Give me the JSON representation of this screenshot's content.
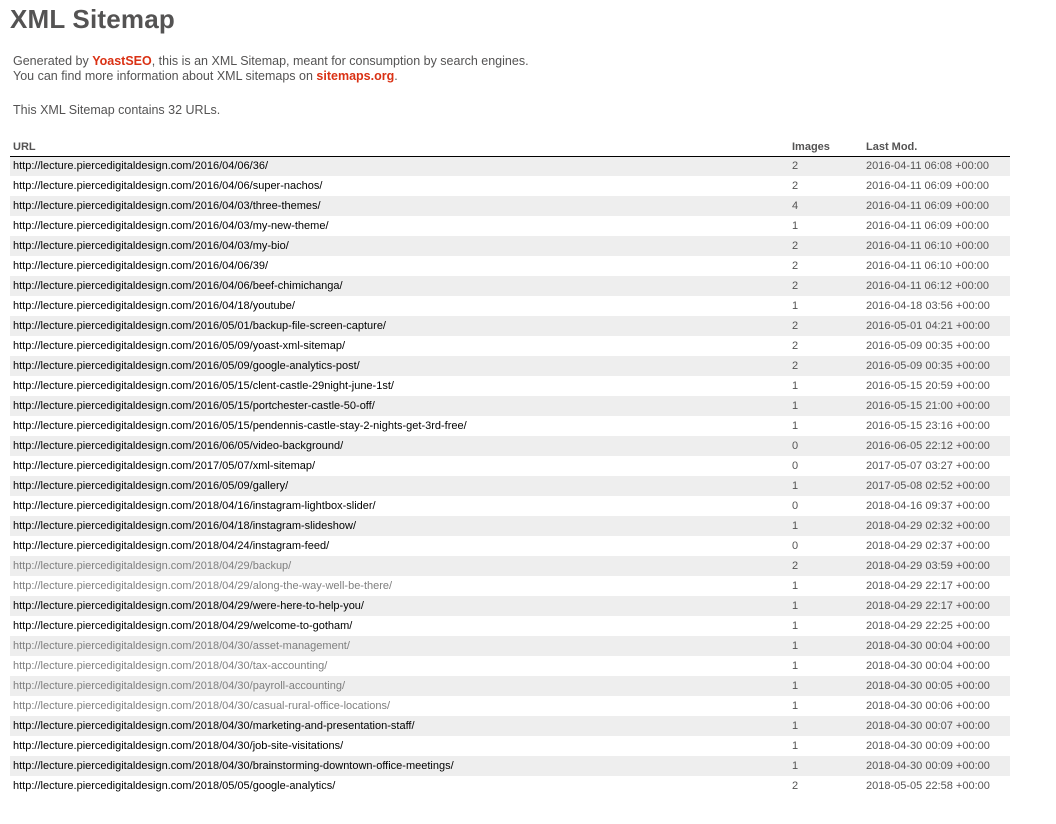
{
  "page": {
    "title": "XML Sitemap",
    "description": {
      "line1_prefix": "Generated by ",
      "line1_link": "YoastSEO",
      "line1_suffix": ", this is an XML Sitemap, meant for consumption by search engines.",
      "line2_prefix": "You can find more information about XML sitemaps on ",
      "line2_link": "sitemaps.org",
      "line2_suffix": "."
    },
    "count_text": "This XML Sitemap contains 32 URLs."
  },
  "colors": {
    "link_accent": "#da3114",
    "text": "#545353",
    "row_alt": "#eeeeee",
    "visited_url": "#7f7f7f"
  },
  "table": {
    "headers": {
      "url": "URL",
      "images": "Images",
      "lastmod": "Last Mod."
    },
    "rows": [
      {
        "url": "http://lecture.piercedigitaldesign.com/2016/04/06/36/",
        "images": "2",
        "lastmod": "2016-04-11 06:08 +00:00",
        "visited": false
      },
      {
        "url": "http://lecture.piercedigitaldesign.com/2016/04/06/super-nachos/",
        "images": "2",
        "lastmod": "2016-04-11 06:09 +00:00",
        "visited": false
      },
      {
        "url": "http://lecture.piercedigitaldesign.com/2016/04/03/three-themes/",
        "images": "4",
        "lastmod": "2016-04-11 06:09 +00:00",
        "visited": false
      },
      {
        "url": "http://lecture.piercedigitaldesign.com/2016/04/03/my-new-theme/",
        "images": "1",
        "lastmod": "2016-04-11 06:09 +00:00",
        "visited": false
      },
      {
        "url": "http://lecture.piercedigitaldesign.com/2016/04/03/my-bio/",
        "images": "2",
        "lastmod": "2016-04-11 06:10 +00:00",
        "visited": false
      },
      {
        "url": "http://lecture.piercedigitaldesign.com/2016/04/06/39/",
        "images": "2",
        "lastmod": "2016-04-11 06:10 +00:00",
        "visited": false
      },
      {
        "url": "http://lecture.piercedigitaldesign.com/2016/04/06/beef-chimichanga/",
        "images": "2",
        "lastmod": "2016-04-11 06:12 +00:00",
        "visited": false
      },
      {
        "url": "http://lecture.piercedigitaldesign.com/2016/04/18/youtube/",
        "images": "1",
        "lastmod": "2016-04-18 03:56 +00:00",
        "visited": false
      },
      {
        "url": "http://lecture.piercedigitaldesign.com/2016/05/01/backup-file-screen-capture/",
        "images": "2",
        "lastmod": "2016-05-01 04:21 +00:00",
        "visited": false
      },
      {
        "url": "http://lecture.piercedigitaldesign.com/2016/05/09/yoast-xml-sitemap/",
        "images": "2",
        "lastmod": "2016-05-09 00:35 +00:00",
        "visited": false
      },
      {
        "url": "http://lecture.piercedigitaldesign.com/2016/05/09/google-analytics-post/",
        "images": "2",
        "lastmod": "2016-05-09 00:35 +00:00",
        "visited": false
      },
      {
        "url": "http://lecture.piercedigitaldesign.com/2016/05/15/clent-castle-29night-june-1st/",
        "images": "1",
        "lastmod": "2016-05-15 20:59 +00:00",
        "visited": false
      },
      {
        "url": "http://lecture.piercedigitaldesign.com/2016/05/15/portchester-castle-50-off/",
        "images": "1",
        "lastmod": "2016-05-15 21:00 +00:00",
        "visited": false
      },
      {
        "url": "http://lecture.piercedigitaldesign.com/2016/05/15/pendennis-castle-stay-2-nights-get-3rd-free/",
        "images": "1",
        "lastmod": "2016-05-15 23:16 +00:00",
        "visited": false
      },
      {
        "url": "http://lecture.piercedigitaldesign.com/2016/06/05/video-background/",
        "images": "0",
        "lastmod": "2016-06-05 22:12 +00:00",
        "visited": false
      },
      {
        "url": "http://lecture.piercedigitaldesign.com/2017/05/07/xml-sitemap/",
        "images": "0",
        "lastmod": "2017-05-07 03:27 +00:00",
        "visited": false
      },
      {
        "url": "http://lecture.piercedigitaldesign.com/2016/05/09/gallery/",
        "images": "1",
        "lastmod": "2017-05-08 02:52 +00:00",
        "visited": false
      },
      {
        "url": "http://lecture.piercedigitaldesign.com/2018/04/16/instagram-lightbox-slider/",
        "images": "0",
        "lastmod": "2018-04-16 09:37 +00:00",
        "visited": false
      },
      {
        "url": "http://lecture.piercedigitaldesign.com/2016/04/18/instagram-slideshow/",
        "images": "1",
        "lastmod": "2018-04-29 02:32 +00:00",
        "visited": false
      },
      {
        "url": "http://lecture.piercedigitaldesign.com/2018/04/24/instagram-feed/",
        "images": "0",
        "lastmod": "2018-04-29 02:37 +00:00",
        "visited": false
      },
      {
        "url": "http://lecture.piercedigitaldesign.com/2018/04/29/backup/",
        "images": "2",
        "lastmod": "2018-04-29 03:59 +00:00",
        "visited": true
      },
      {
        "url": "http://lecture.piercedigitaldesign.com/2018/04/29/along-the-way-well-be-there/",
        "images": "1",
        "lastmod": "2018-04-29 22:17 +00:00",
        "visited": true
      },
      {
        "url": "http://lecture.piercedigitaldesign.com/2018/04/29/were-here-to-help-you/",
        "images": "1",
        "lastmod": "2018-04-29 22:17 +00:00",
        "visited": false
      },
      {
        "url": "http://lecture.piercedigitaldesign.com/2018/04/29/welcome-to-gotham/",
        "images": "1",
        "lastmod": "2018-04-29 22:25 +00:00",
        "visited": false
      },
      {
        "url": "http://lecture.piercedigitaldesign.com/2018/04/30/asset-management/",
        "images": "1",
        "lastmod": "2018-04-30 00:04 +00:00",
        "visited": true
      },
      {
        "url": "http://lecture.piercedigitaldesign.com/2018/04/30/tax-accounting/",
        "images": "1",
        "lastmod": "2018-04-30 00:04 +00:00",
        "visited": true
      },
      {
        "url": "http://lecture.piercedigitaldesign.com/2018/04/30/payroll-accounting/",
        "images": "1",
        "lastmod": "2018-04-30 00:05 +00:00",
        "visited": true
      },
      {
        "url": "http://lecture.piercedigitaldesign.com/2018/04/30/casual-rural-office-locations/",
        "images": "1",
        "lastmod": "2018-04-30 00:06 +00:00",
        "visited": true
      },
      {
        "url": "http://lecture.piercedigitaldesign.com/2018/04/30/marketing-and-presentation-staff/",
        "images": "1",
        "lastmod": "2018-04-30 00:07 +00:00",
        "visited": false
      },
      {
        "url": "http://lecture.piercedigitaldesign.com/2018/04/30/job-site-visitations/",
        "images": "1",
        "lastmod": "2018-04-30 00:09 +00:00",
        "visited": false
      },
      {
        "url": "http://lecture.piercedigitaldesign.com/2018/04/30/brainstorming-downtown-office-meetings/",
        "images": "1",
        "lastmod": "2018-04-30 00:09 +00:00",
        "visited": false
      },
      {
        "url": "http://lecture.piercedigitaldesign.com/2018/05/05/google-analytics/",
        "images": "2",
        "lastmod": "2018-05-05 22:58 +00:00",
        "visited": false
      }
    ]
  }
}
